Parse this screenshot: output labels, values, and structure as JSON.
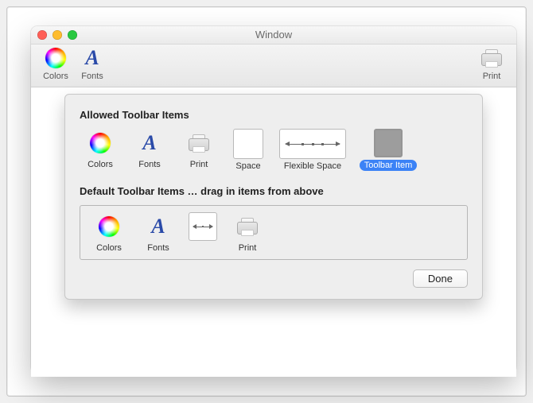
{
  "window": {
    "title": "Window"
  },
  "toolbar": {
    "colors": "Colors",
    "fonts": "Fonts",
    "print": "Print"
  },
  "sheet": {
    "allowed_title": "Allowed Toolbar Items",
    "default_title": "Default Toolbar Items … drag in items from above",
    "items": {
      "colors": "Colors",
      "fonts": "Fonts",
      "print": "Print",
      "space": "Space",
      "flexible_space": "Flexible Space",
      "toolbar_item": "Toolbar Item"
    },
    "done": "Done"
  }
}
